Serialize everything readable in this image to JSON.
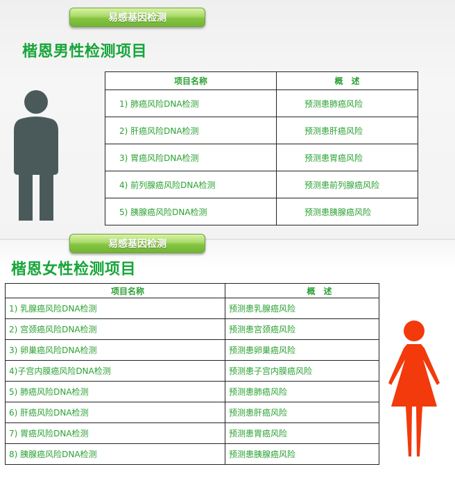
{
  "male": {
    "badge": "易感基因检测",
    "title": "楷恩男性检测项目",
    "headers": [
      "项目名称",
      "概　述"
    ],
    "rows": [
      [
        "1) 肺癌风险DNA检测",
        "预测患肺癌风险"
      ],
      [
        "2) 肝癌风险DNA检测",
        "预测患肝癌风险"
      ],
      [
        "3) 胃癌风险DNA检测",
        "预测患胃癌风险"
      ],
      [
        "4) 前列腺癌风险DNA检测",
        "预测患前列腺癌风险"
      ],
      [
        "5) 胰腺癌风险DNA检测",
        "预测患胰腺癌风险"
      ]
    ],
    "figure_icon": "man-icon",
    "figure_color": "#4a5a5a"
  },
  "female": {
    "badge": "易感基因检测",
    "title": "楷恩女性检测项目",
    "headers": [
      "项目名称",
      "概　述"
    ],
    "rows": [
      [
        "1) 乳腺癌风险DNA检测",
        "预测患乳腺癌风险"
      ],
      [
        "2) 宫颈癌风险DNA检测",
        "预测患宫颈癌风险"
      ],
      [
        "3) 卵巢癌风险DNA检测",
        "预测患卵巢癌风险"
      ],
      [
        "4)子宫内膜癌风险DNA检测",
        "预测患子宫内膜癌风险"
      ],
      [
        "5) 肺癌风险DNA检测",
        "预测患肺癌风险"
      ],
      [
        "6) 肝癌风险DNA检测",
        "预测患肝癌风险"
      ],
      [
        "7) 胃癌风险DNA检测",
        "预测患胃癌风险"
      ],
      [
        "8) 胰腺癌风险DNA检测",
        "预测患胰腺癌风险"
      ]
    ],
    "figure_icon": "woman-icon",
    "figure_color": "#f23a0c"
  },
  "colors": {
    "title_green": "#17a53a",
    "text_green": "#2aa132",
    "badge_green": "#86c544"
  }
}
